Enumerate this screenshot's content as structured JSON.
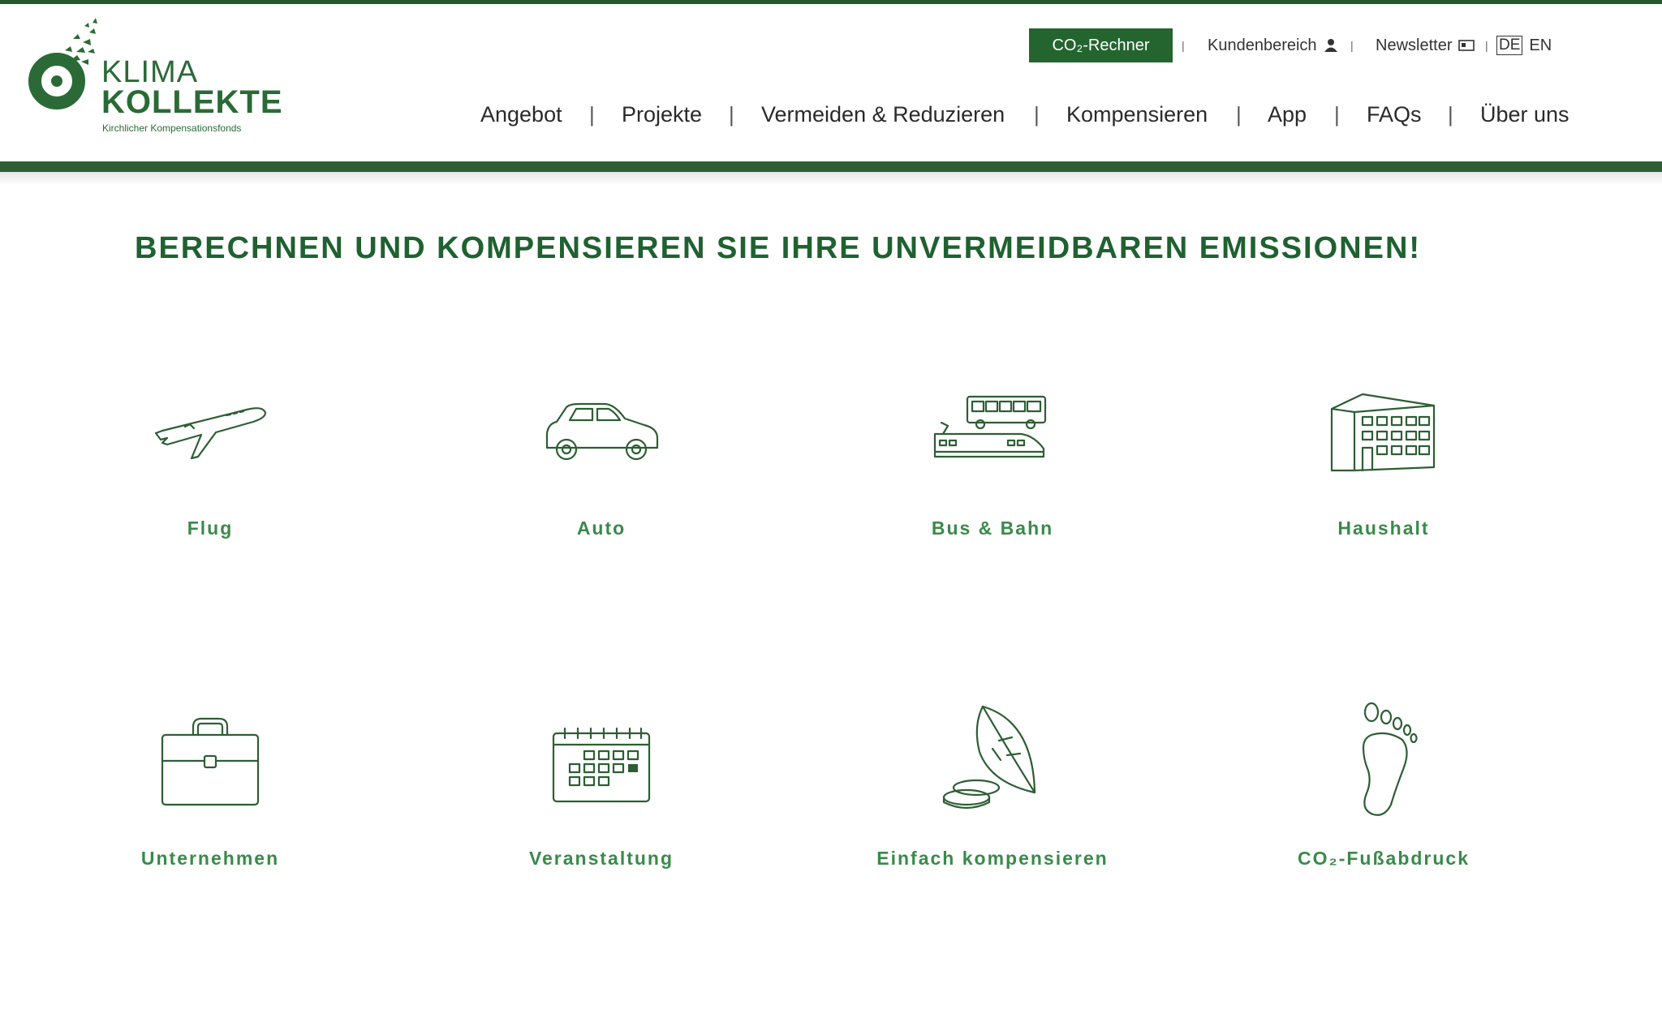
{
  "brand": {
    "word1": "KLIMA",
    "word2": "KOLLEKTE",
    "tagline": "Kirchlicher Kompensationsfonds",
    "color": "#2b6a36"
  },
  "utility": {
    "co2_button": "CO₂-Rechner",
    "customer_area": "Kundenbereich",
    "newsletter": "Newsletter",
    "lang_de": "DE",
    "lang_en": "EN",
    "separator": "|"
  },
  "nav": {
    "items": [
      "Angebot",
      "Projekte",
      "Vermeiden & Reduzieren",
      "Kompensieren",
      "App",
      "FAQs",
      "Über uns"
    ],
    "separator": "|"
  },
  "headline": "BERECHNEN UND KOMPENSIEREN SIE IHRE UNVERMEIDBAREN EMISSIONEN!",
  "tiles": [
    {
      "label": "Flug",
      "icon": "airplane-icon"
    },
    {
      "label": "Auto",
      "icon": "car-icon"
    },
    {
      "label": "Bus & Bahn",
      "icon": "bus-train-icon"
    },
    {
      "label": "Haushalt",
      "icon": "building-icon"
    },
    {
      "label": "Unternehmen",
      "icon": "briefcase-icon"
    },
    {
      "label": "Veranstaltung",
      "icon": "calendar-icon"
    },
    {
      "label": "Einfach kompensieren",
      "icon": "leaf-coins-icon"
    },
    {
      "label": "CO₂-Fußabdruck",
      "icon": "footprint-icon"
    }
  ],
  "colors": {
    "primary": "#24652f",
    "bar": "#2e5e35",
    "tile_label": "#3a8a4b"
  }
}
